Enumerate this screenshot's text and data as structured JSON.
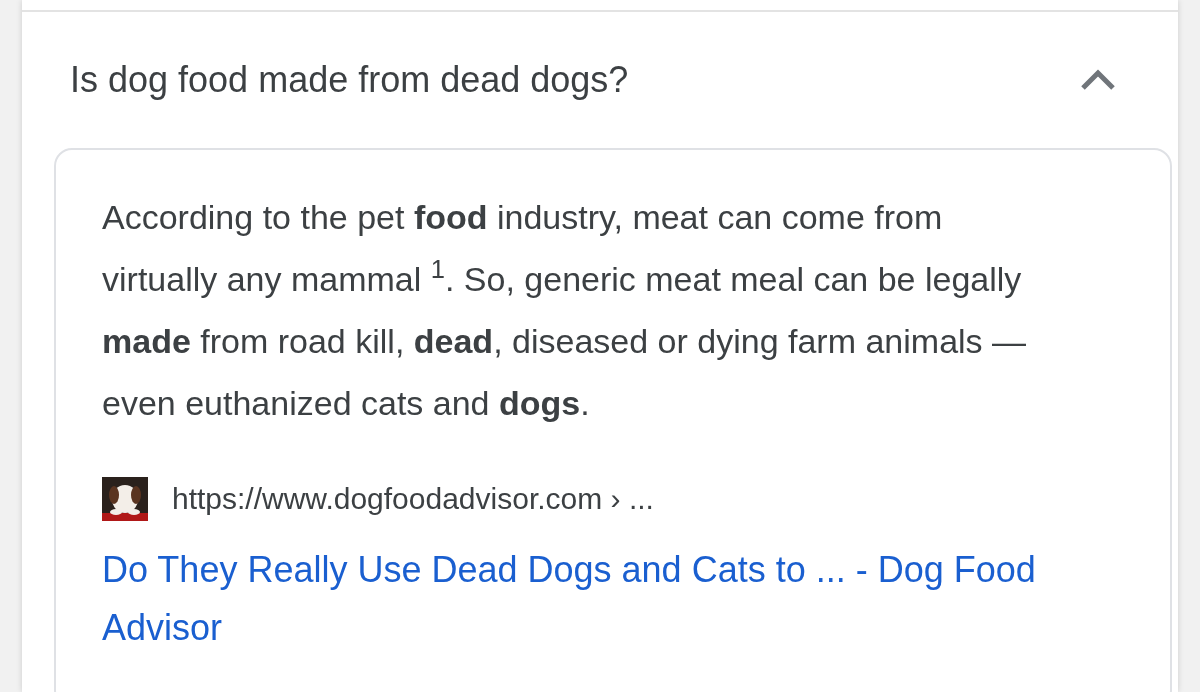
{
  "question": {
    "text": "Is dog food made from dead dogs?",
    "expanded": true
  },
  "answer": {
    "snippet": "According to the pet **food** industry, meat can come from virtually any mammal $^{1}$. So, generic meat meal can be legally **made** from road kill, **dead**, diseased or dying farm animals — even euthanized cats and **dogs**.",
    "source": {
      "url": "https://www.dogfoodadvisor.com › ...",
      "title": "Do They Really Use Dead Dogs and Cats to ... - Dog Food Advisor"
    }
  }
}
